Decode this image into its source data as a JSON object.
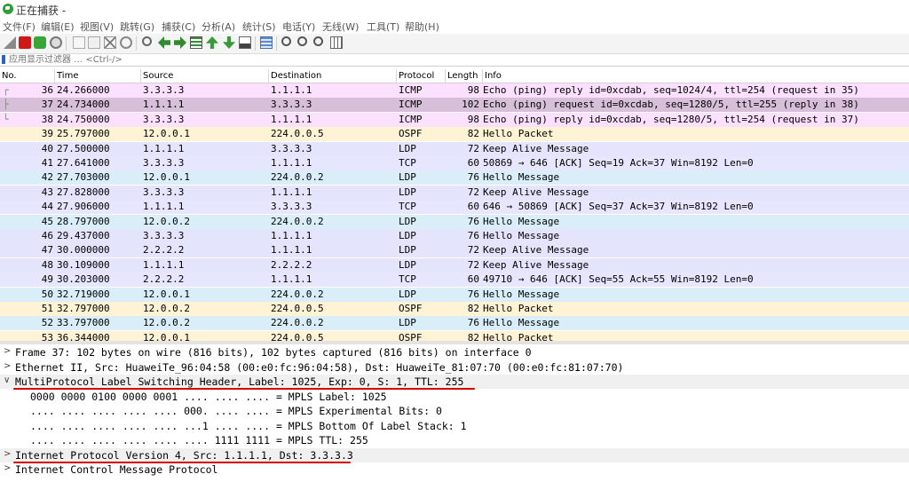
{
  "window": {
    "title": "正在捕获 -"
  },
  "menu": [
    "文件(F)",
    "编辑(E)",
    "视图(V)",
    "跳转(G)",
    "捕获(C)",
    "分析(A)",
    "统计(S)",
    "电话(Y)",
    "无线(W)",
    "工具(T)",
    "帮助(H)"
  ],
  "toolbar_icons": [
    "shark-fin-icon",
    "stop-icon",
    "restart-icon",
    "options-icon",
    "open-icon",
    "save-icon",
    "close-file-icon",
    "reload-icon",
    "find-icon",
    "back-icon",
    "forward-icon",
    "goto-icon",
    "first-packet-icon",
    "last-packet-icon",
    "autoscroll-icon",
    "colorize-icon",
    "zoom-in-icon",
    "zoom-out-icon",
    "zoom-normal-icon",
    "resize-columns-icon"
  ],
  "filter": {
    "placeholder": "应用显示过滤器 … <Ctrl-/>"
  },
  "columns": [
    "No.",
    "Time",
    "Source",
    "Destination",
    "Protocol",
    "Length",
    "Info"
  ],
  "colors": {
    "icmp": "#fce0ff",
    "selected": "#d7bfd9",
    "ospf": "#fff3d6",
    "ldp": "#e4e4fc",
    "tcp": "#e7e6ff",
    "hello": "#daeefa",
    "annotation": "#d40000"
  },
  "packets": [
    {
      "no": "36",
      "time": "24.266000",
      "src": "3.3.3.3",
      "dst": "1.1.1.1",
      "proto": "ICMP",
      "len": "98",
      "info": "Echo (ping) reply    id=0xcdab, seq=1024/4, ttl=254 (request in 35)",
      "bg": "icmp"
    },
    {
      "no": "37",
      "time": "24.734000",
      "src": "1.1.1.1",
      "dst": "3.3.3.3",
      "proto": "ICMP",
      "len": "102",
      "info": "Echo (ping) request  id=0xcdab, seq=1280/5, ttl=255 (reply in 38)",
      "bg": "selected"
    },
    {
      "no": "38",
      "time": "24.750000",
      "src": "3.3.3.3",
      "dst": "1.1.1.1",
      "proto": "ICMP",
      "len": "98",
      "info": "Echo (ping) reply    id=0xcdab, seq=1280/5, ttl=254 (request in 37)",
      "bg": "icmp"
    },
    {
      "no": "39",
      "time": "25.797000",
      "src": "12.0.0.1",
      "dst": "224.0.0.5",
      "proto": "OSPF",
      "len": "82",
      "info": "Hello Packet",
      "bg": "ospf"
    },
    {
      "no": "40",
      "time": "27.500000",
      "src": "1.1.1.1",
      "dst": "3.3.3.3",
      "proto": "LDP",
      "len": "72",
      "info": "Keep Alive Message",
      "bg": "ldp"
    },
    {
      "no": "41",
      "time": "27.641000",
      "src": "3.3.3.3",
      "dst": "1.1.1.1",
      "proto": "TCP",
      "len": "60",
      "info": "50869 → 646 [ACK] Seq=19 Ack=37 Win=8192 Len=0",
      "bg": "tcp"
    },
    {
      "no": "42",
      "time": "27.703000",
      "src": "12.0.0.1",
      "dst": "224.0.0.2",
      "proto": "LDP",
      "len": "76",
      "info": "Hello Message",
      "bg": "hello"
    },
    {
      "no": "43",
      "time": "27.828000",
      "src": "3.3.3.3",
      "dst": "1.1.1.1",
      "proto": "LDP",
      "len": "72",
      "info": "Keep Alive Message",
      "bg": "ldp"
    },
    {
      "no": "44",
      "time": "27.906000",
      "src": "1.1.1.1",
      "dst": "3.3.3.3",
      "proto": "TCP",
      "len": "60",
      "info": "646 → 50869 [ACK] Seq=37 Ack=37 Win=8192 Len=0",
      "bg": "tcp"
    },
    {
      "no": "45",
      "time": "28.797000",
      "src": "12.0.0.2",
      "dst": "224.0.0.2",
      "proto": "LDP",
      "len": "76",
      "info": "Hello Message",
      "bg": "hello"
    },
    {
      "no": "46",
      "time": "29.437000",
      "src": "3.3.3.3",
      "dst": "1.1.1.1",
      "proto": "LDP",
      "len": "76",
      "info": "Hello Message",
      "bg": "ldp"
    },
    {
      "no": "47",
      "time": "30.000000",
      "src": "2.2.2.2",
      "dst": "1.1.1.1",
      "proto": "LDP",
      "len": "72",
      "info": "Keep Alive Message",
      "bg": "ldp"
    },
    {
      "no": "48",
      "time": "30.109000",
      "src": "1.1.1.1",
      "dst": "2.2.2.2",
      "proto": "LDP",
      "len": "72",
      "info": "Keep Alive Message",
      "bg": "ldp"
    },
    {
      "no": "49",
      "time": "30.203000",
      "src": "2.2.2.2",
      "dst": "1.1.1.1",
      "proto": "TCP",
      "len": "60",
      "info": "49710 → 646 [ACK] Seq=55 Ack=55 Win=8192 Len=0",
      "bg": "tcp"
    },
    {
      "no": "50",
      "time": "32.719000",
      "src": "12.0.0.1",
      "dst": "224.0.0.2",
      "proto": "LDP",
      "len": "76",
      "info": "Hello Message",
      "bg": "hello"
    },
    {
      "no": "51",
      "time": "32.797000",
      "src": "12.0.0.2",
      "dst": "224.0.0.5",
      "proto": "OSPF",
      "len": "82",
      "info": "Hello Packet",
      "bg": "ospf"
    },
    {
      "no": "52",
      "time": "33.797000",
      "src": "12.0.0.2",
      "dst": "224.0.0.2",
      "proto": "LDP",
      "len": "76",
      "info": "Hello Message",
      "bg": "hello"
    },
    {
      "no": "53",
      "time": "36.344000",
      "src": "12.0.0.1",
      "dst": "224.0.0.5",
      "proto": "OSPF",
      "len": "82",
      "info": "Hello Packet",
      "bg": "ospf"
    }
  ],
  "details": [
    {
      "arrow": ">",
      "text": "Frame 37: 102 bytes on wire (816 bits), 102 bytes captured (816 bits) on interface 0",
      "bg": "#ffffff",
      "indent": 0
    },
    {
      "arrow": ">",
      "text": "Ethernet II, Src: HuaweiTe_96:04:58 (00:e0:fc:96:04:58), Dst: HuaweiTe_81:07:70 (00:e0:fc:81:07:70)",
      "bg": "#ffffff",
      "indent": 0
    },
    {
      "arrow": "∨",
      "text": "MultiProtocol Label Switching Header, Label: 1025, Exp: 0, S: 1, TTL: 255",
      "bg": "#f0f0f0",
      "indent": 0
    },
    {
      "arrow": "",
      "text": "0000 0000 0100 0000 0001 .... .... .... = MPLS Label: 1025",
      "bg": "#ffffff",
      "indent": 1
    },
    {
      "arrow": "",
      "text": ".... .... .... .... .... 000. .... .... = MPLS Experimental Bits: 0",
      "bg": "#ffffff",
      "indent": 1
    },
    {
      "arrow": "",
      "text": ".... .... .... .... .... ...1 .... .... = MPLS Bottom Of Label Stack: 1",
      "bg": "#ffffff",
      "indent": 1
    },
    {
      "arrow": "",
      "text": ".... .... .... .... .... .... 1111 1111 = MPLS TTL: 255",
      "bg": "#ffffff",
      "indent": 1
    },
    {
      "arrow": ">",
      "text": "Internet Protocol Version 4, Src: 1.1.1.1, Dst: 3.3.3.3",
      "bg": "#f0f0f0",
      "indent": 0
    },
    {
      "arrow": ">",
      "text": "Internet Control Message Protocol",
      "bg": "#ffffff",
      "indent": 0
    }
  ]
}
